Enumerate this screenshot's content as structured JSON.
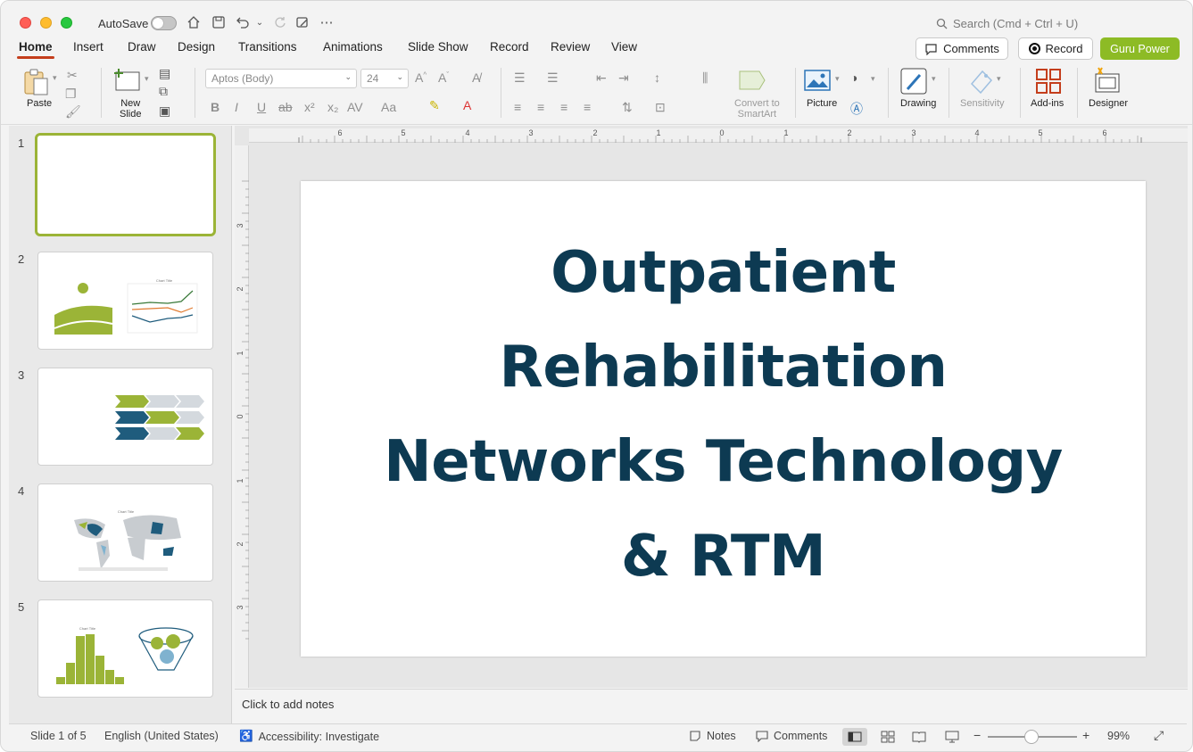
{
  "titlebar": {
    "autosave_label": "AutoSave",
    "search_placeholder": "Search (Cmd + Ctrl + U)"
  },
  "tabs": [
    "Home",
    "Insert",
    "Draw",
    "Design",
    "Transitions",
    "Animations",
    "Slide Show",
    "Record",
    "Review",
    "View"
  ],
  "active_tab": "Home",
  "header_buttons": {
    "comments": "Comments",
    "record": "Record",
    "guru": "Guru Power"
  },
  "ribbon": {
    "paste": "Paste",
    "new_slide": "New\nSlide",
    "font_name": "Aptos (Body)",
    "font_size": "24",
    "convert": "Convert to\nSmartArt",
    "picture": "Picture",
    "drawing": "Drawing",
    "sensitivity": "Sensitivity",
    "addins": "Add-ins",
    "designer": "Designer"
  },
  "slides": [
    {
      "number": "1"
    },
    {
      "number": "2"
    },
    {
      "number": "3"
    },
    {
      "number": "4"
    },
    {
      "number": "5"
    }
  ],
  "ruler": {
    "top_ticks": [
      "6",
      "5",
      "4",
      "3",
      "2",
      "1",
      "0",
      "1",
      "2",
      "3",
      "4",
      "5",
      "6"
    ],
    "left_ticks": [
      "3",
      "2",
      "1",
      "0",
      "1",
      "2",
      "3"
    ]
  },
  "slide": {
    "title_lines": [
      "Outpatient",
      "Rehabilitation",
      "Networks Technology",
      "& RTM"
    ]
  },
  "thumbnail_text": {
    "chart_title": "Chart Title"
  },
  "notes_placeholder": "Click to add notes",
  "status": {
    "slide_count": "Slide 1 of 5",
    "language": "English (United States)",
    "accessibility": "Accessibility: Investigate",
    "notes": "Notes",
    "comments": "Comments",
    "zoom": "99%"
  },
  "colors": {
    "accent_green": "#8dbb25",
    "title_navy": "#0d3a52",
    "tab_underline": "#c43e1c"
  }
}
